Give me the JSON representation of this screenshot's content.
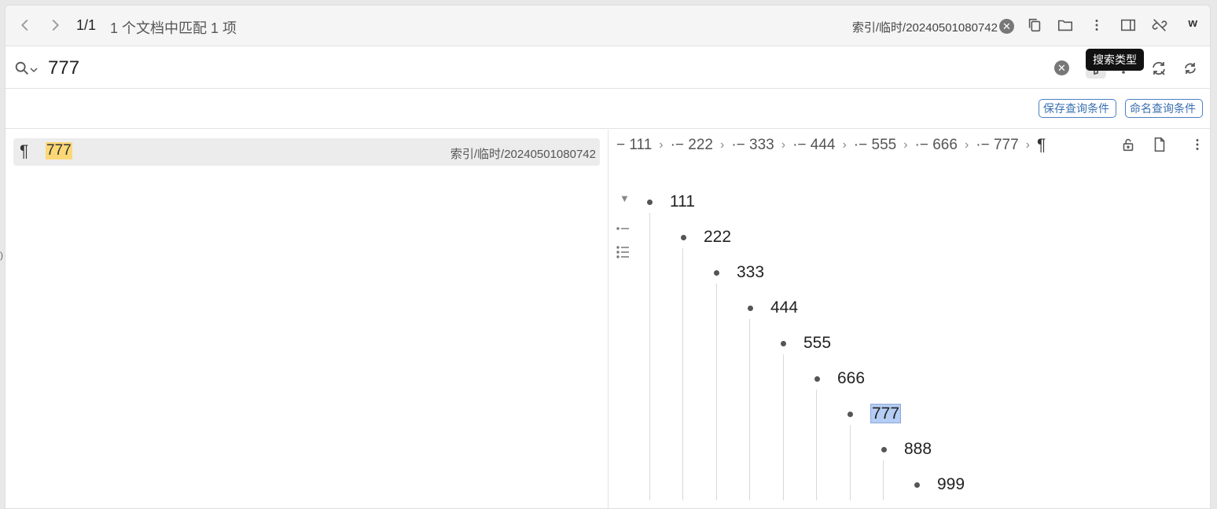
{
  "topbar": {
    "counter": "1/1",
    "match_summary": "1 个文档中匹配 1 项",
    "doc_path": "索引/临时/20240501080742",
    "badge": "w"
  },
  "search": {
    "query": "777",
    "tooltip": "搜索类型"
  },
  "query_buttons": {
    "save": "保存查询条件",
    "named": "命名查询条件"
  },
  "results": [
    {
      "match": "777",
      "path": "索引/临时/20240501080742"
    }
  ],
  "preview": {
    "breadcrumbs": [
      "111",
      "222",
      "333",
      "444",
      "555",
      "666",
      "777"
    ],
    "tree": [
      {
        "label": "111"
      },
      {
        "label": "222"
      },
      {
        "label": "333"
      },
      {
        "label": "444"
      },
      {
        "label": "555"
      },
      {
        "label": "666"
      },
      {
        "label": "777",
        "selected": true
      },
      {
        "label": "888"
      },
      {
        "label": "999"
      }
    ]
  },
  "icons": [
    "chevron-left-icon",
    "chevron-right-icon",
    "copy-icon",
    "folder-icon",
    "more-icon",
    "sidebar-icon",
    "unlink-icon",
    "search-icon",
    "clear-icon",
    "filter-icon",
    "regex-icon",
    "replace-icon",
    "refresh-icon",
    "lock-icon",
    "document-icon"
  ]
}
